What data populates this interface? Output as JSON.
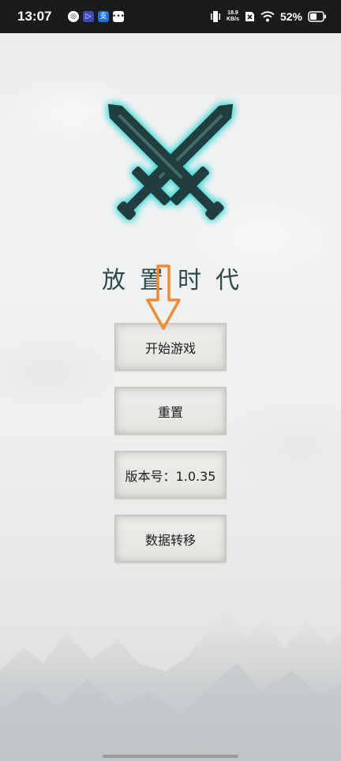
{
  "status_bar": {
    "time": "13:07",
    "net_speed_value": "18.9",
    "net_speed_unit": "KB/s",
    "battery_percent": "52%"
  },
  "game": {
    "title": "放置时代",
    "logo_icon": "crossed-swords-icon",
    "accent_color": "#34d6d6"
  },
  "menu": {
    "start_label": "开始游戏",
    "reset_label": "重置",
    "version_label": "版本号：1.0.35",
    "transfer_label": "数据转移"
  },
  "annotation": {
    "arrow_icon": "down-arrow-icon",
    "arrow_color": "#f08a2c"
  }
}
